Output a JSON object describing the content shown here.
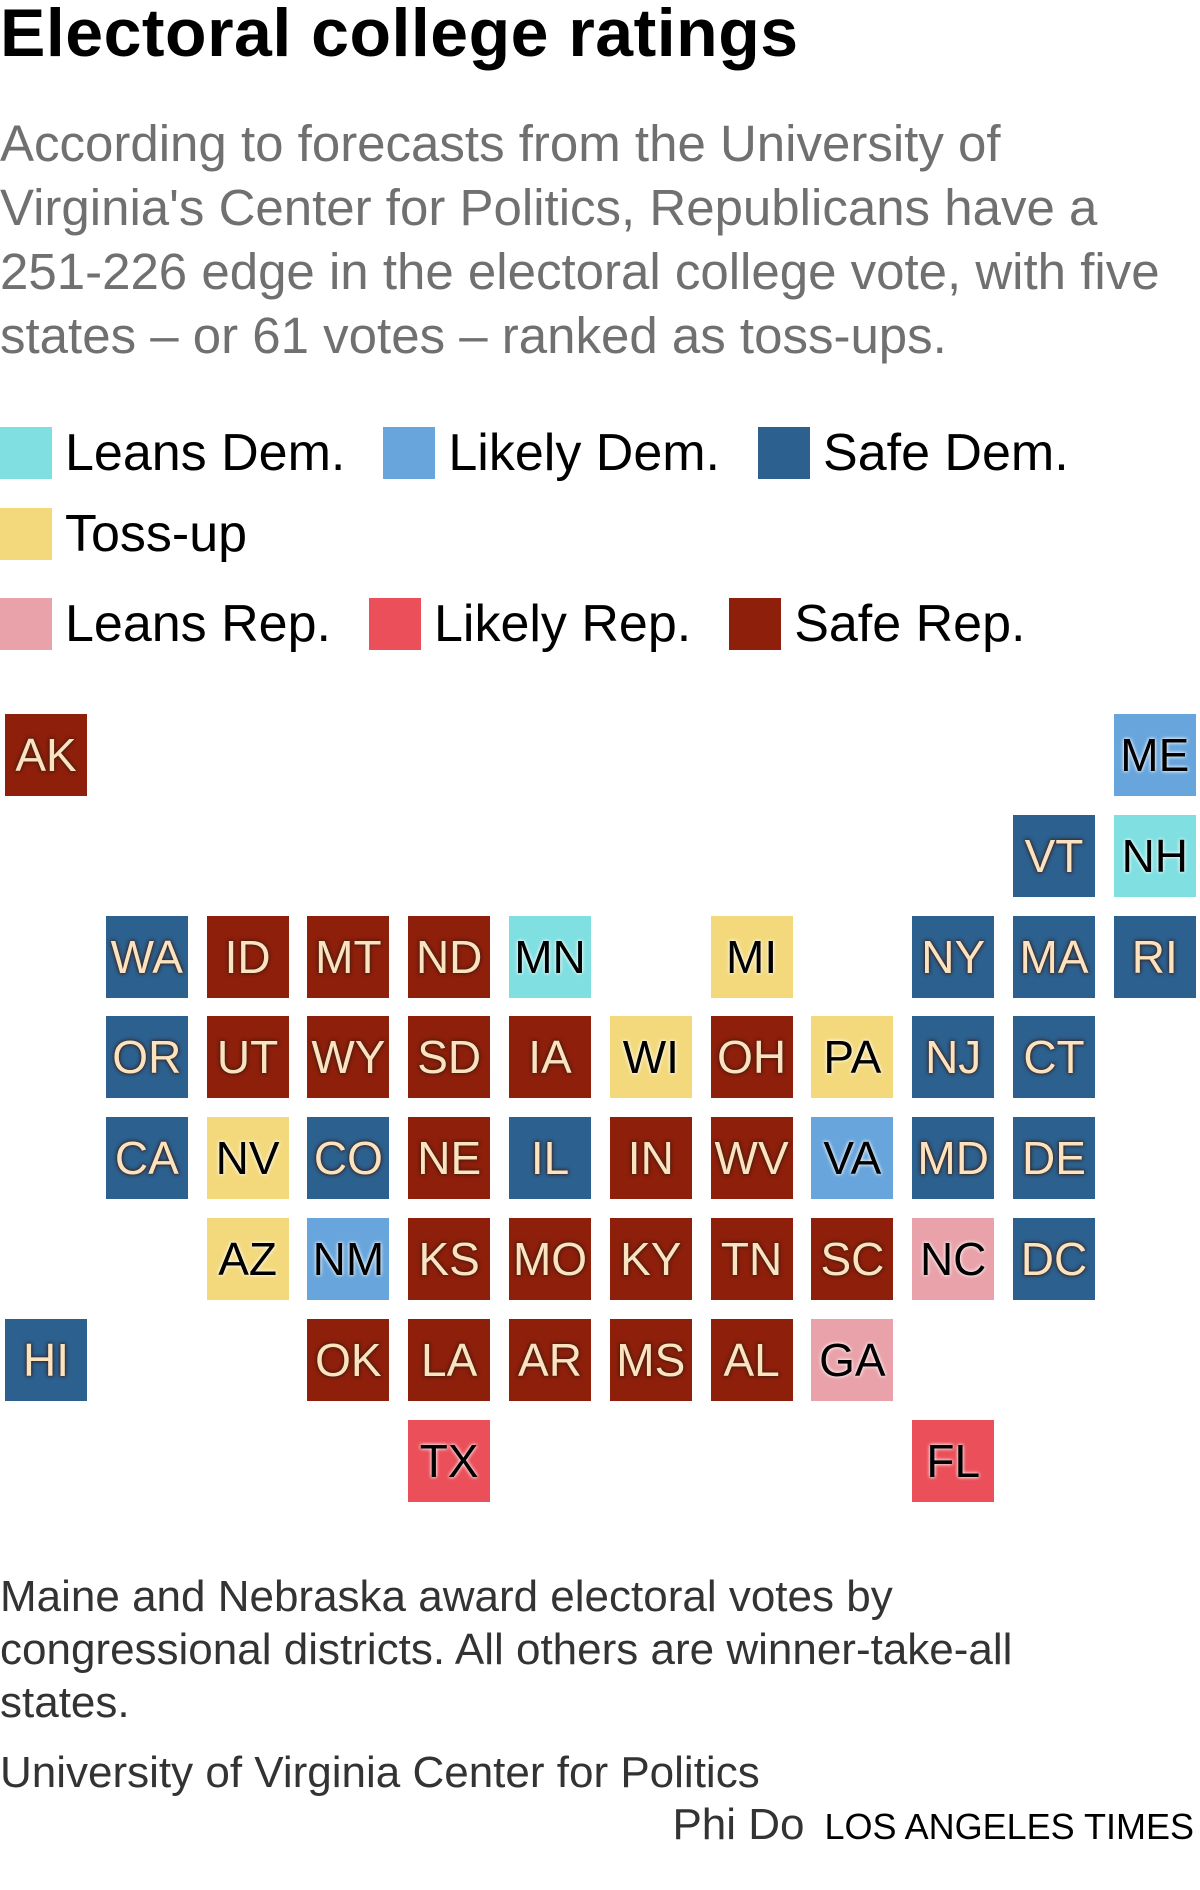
{
  "chart_data": {
    "type": "tile-map",
    "title": "Electoral college ratings",
    "subtitle": "According to forecasts from the University of Virginia's Center for Politics, Republicans have a 251-226 edge in the electoral college vote, with five states – or 61 votes – ranked as toss-ups.",
    "categories": [
      {
        "key": "leans_dem",
        "label": "Leans Dem.",
        "color": "#7fdfe1"
      },
      {
        "key": "likely_dem",
        "label": "Likely Dem.",
        "color": "#68a5dc"
      },
      {
        "key": "safe_dem",
        "label": "Safe Dem.",
        "color": "#2c608e"
      },
      {
        "key": "tossup",
        "label": "Toss-up",
        "color": "#f3d97c"
      },
      {
        "key": "leans_rep",
        "label": "Leans Rep.",
        "color": "#e9a2a9"
      },
      {
        "key": "likely_rep",
        "label": "Likely Rep.",
        "color": "#ea4f5a"
      },
      {
        "key": "safe_rep",
        "label": "Safe Rep.",
        "color": "#8e1f0b"
      }
    ],
    "legend_placement": "top",
    "states": [
      {
        "state": "AK",
        "row": 0,
        "col": 0,
        "rating": "safe_rep"
      },
      {
        "state": "ME",
        "row": 0,
        "col": 11,
        "rating": "likely_dem"
      },
      {
        "state": "VT",
        "row": 1,
        "col": 10,
        "rating": "safe_dem"
      },
      {
        "state": "NH",
        "row": 1,
        "col": 11,
        "rating": "leans_dem"
      },
      {
        "state": "WA",
        "row": 2,
        "col": 1,
        "rating": "safe_dem"
      },
      {
        "state": "ID",
        "row": 2,
        "col": 2,
        "rating": "safe_rep"
      },
      {
        "state": "MT",
        "row": 2,
        "col": 3,
        "rating": "safe_rep"
      },
      {
        "state": "ND",
        "row": 2,
        "col": 4,
        "rating": "safe_rep"
      },
      {
        "state": "MN",
        "row": 2,
        "col": 5,
        "rating": "leans_dem"
      },
      {
        "state": "MI",
        "row": 2,
        "col": 7,
        "rating": "tossup"
      },
      {
        "state": "NY",
        "row": 2,
        "col": 9,
        "rating": "safe_dem"
      },
      {
        "state": "MA",
        "row": 2,
        "col": 10,
        "rating": "safe_dem"
      },
      {
        "state": "RI",
        "row": 2,
        "col": 11,
        "rating": "safe_dem"
      },
      {
        "state": "OR",
        "row": 3,
        "col": 1,
        "rating": "safe_dem"
      },
      {
        "state": "UT",
        "row": 3,
        "col": 2,
        "rating": "safe_rep"
      },
      {
        "state": "WY",
        "row": 3,
        "col": 3,
        "rating": "safe_rep"
      },
      {
        "state": "SD",
        "row": 3,
        "col": 4,
        "rating": "safe_rep"
      },
      {
        "state": "IA",
        "row": 3,
        "col": 5,
        "rating": "safe_rep"
      },
      {
        "state": "WI",
        "row": 3,
        "col": 6,
        "rating": "tossup"
      },
      {
        "state": "OH",
        "row": 3,
        "col": 7,
        "rating": "safe_rep"
      },
      {
        "state": "PA",
        "row": 3,
        "col": 8,
        "rating": "tossup"
      },
      {
        "state": "NJ",
        "row": 3,
        "col": 9,
        "rating": "safe_dem"
      },
      {
        "state": "CT",
        "row": 3,
        "col": 10,
        "rating": "safe_dem"
      },
      {
        "state": "CA",
        "row": 4,
        "col": 1,
        "rating": "safe_dem"
      },
      {
        "state": "NV",
        "row": 4,
        "col": 2,
        "rating": "tossup"
      },
      {
        "state": "CO",
        "row": 4,
        "col": 3,
        "rating": "safe_dem"
      },
      {
        "state": "NE",
        "row": 4,
        "col": 4,
        "rating": "safe_rep"
      },
      {
        "state": "IL",
        "row": 4,
        "col": 5,
        "rating": "safe_dem"
      },
      {
        "state": "IN",
        "row": 4,
        "col": 6,
        "rating": "safe_rep"
      },
      {
        "state": "WV",
        "row": 4,
        "col": 7,
        "rating": "safe_rep"
      },
      {
        "state": "VA",
        "row": 4,
        "col": 8,
        "rating": "likely_dem"
      },
      {
        "state": "MD",
        "row": 4,
        "col": 9,
        "rating": "safe_dem"
      },
      {
        "state": "DE",
        "row": 4,
        "col": 10,
        "rating": "safe_dem"
      },
      {
        "state": "AZ",
        "row": 5,
        "col": 2,
        "rating": "tossup"
      },
      {
        "state": "NM",
        "row": 5,
        "col": 3,
        "rating": "likely_dem"
      },
      {
        "state": "KS",
        "row": 5,
        "col": 4,
        "rating": "safe_rep"
      },
      {
        "state": "MO",
        "row": 5,
        "col": 5,
        "rating": "safe_rep"
      },
      {
        "state": "KY",
        "row": 5,
        "col": 6,
        "rating": "safe_rep"
      },
      {
        "state": "TN",
        "row": 5,
        "col": 7,
        "rating": "safe_rep"
      },
      {
        "state": "SC",
        "row": 5,
        "col": 8,
        "rating": "safe_rep"
      },
      {
        "state": "NC",
        "row": 5,
        "col": 9,
        "rating": "leans_rep"
      },
      {
        "state": "DC",
        "row": 5,
        "col": 10,
        "rating": "safe_dem"
      },
      {
        "state": "HI",
        "row": 6,
        "col": 0,
        "rating": "safe_dem"
      },
      {
        "state": "OK",
        "row": 6,
        "col": 3,
        "rating": "safe_rep"
      },
      {
        "state": "LA",
        "row": 6,
        "col": 4,
        "rating": "safe_rep"
      },
      {
        "state": "AR",
        "row": 6,
        "col": 5,
        "rating": "safe_rep"
      },
      {
        "state": "MS",
        "row": 6,
        "col": 6,
        "rating": "safe_rep"
      },
      {
        "state": "AL",
        "row": 6,
        "col": 7,
        "rating": "safe_rep"
      },
      {
        "state": "GA",
        "row": 6,
        "col": 8,
        "rating": "leans_rep"
      },
      {
        "state": "TX",
        "row": 7,
        "col": 4,
        "rating": "likely_rep"
      },
      {
        "state": "FL",
        "row": 7,
        "col": 9,
        "rating": "likely_rep"
      }
    ]
  },
  "footer": {
    "note": "Maine and Nebraska award electoral votes by congressional districts. All others are winner-take-all states.",
    "source": "University of Virginia Center for Politics",
    "byline": "Phi Do",
    "publisher": "LOS ANGELES TIMES"
  }
}
